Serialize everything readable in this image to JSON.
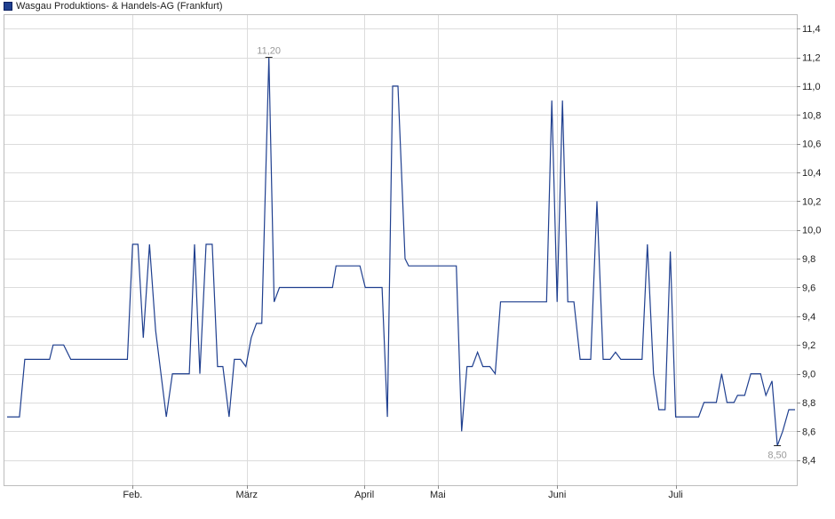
{
  "chart_data": {
    "type": "line",
    "title": "",
    "xlabel": "",
    "ylabel": "",
    "legend": "top-left",
    "grid": true,
    "series": [
      {
        "name": "Wasgau Produktions- & Handels-AG (Frankfurt)",
        "color": "#1f3f8f",
        "points": [
          [
            4,
            8.7
          ],
          [
            18,
            8.7
          ],
          [
            24,
            9.1
          ],
          [
            52,
            9.1
          ],
          [
            56,
            9.2
          ],
          [
            68,
            9.2
          ],
          [
            76,
            9.1
          ],
          [
            140,
            9.1
          ],
          [
            146,
            9.9
          ],
          [
            152,
            9.9
          ],
          [
            158,
            9.25
          ],
          [
            165,
            9.9
          ],
          [
            172,
            9.3
          ],
          [
            184,
            8.7
          ],
          [
            191,
            9.0
          ],
          [
            210,
            9.0
          ],
          [
            216,
            9.9
          ],
          [
            222,
            9.0
          ],
          [
            229,
            9.9
          ],
          [
            236,
            9.9
          ],
          [
            242,
            9.05
          ],
          [
            248,
            9.05
          ],
          [
            255,
            8.7
          ],
          [
            261,
            9.1
          ],
          [
            268,
            9.1
          ],
          [
            274,
            9.05
          ],
          [
            280,
            9.25
          ],
          [
            286,
            9.35
          ],
          [
            292,
            9.35
          ],
          [
            300,
            11.2
          ],
          [
            306,
            9.5
          ],
          [
            312,
            9.6
          ],
          [
            372,
            9.6
          ],
          [
            376,
            9.75
          ],
          [
            403,
            9.75
          ],
          [
            409,
            9.6
          ],
          [
            428,
            9.6
          ],
          [
            434,
            8.7
          ],
          [
            440,
            11.0
          ],
          [
            446,
            11.0
          ],
          [
            454,
            9.8
          ],
          [
            458,
            9.75
          ],
          [
            512,
            9.75
          ],
          [
            518,
            8.6
          ],
          [
            524,
            9.05
          ],
          [
            530,
            9.05
          ],
          [
            536,
            9.15
          ],
          [
            542,
            9.05
          ],
          [
            550,
            9.05
          ],
          [
            556,
            9.0
          ],
          [
            562,
            9.5
          ],
          [
            614,
            9.5
          ],
          [
            620,
            10.9
          ],
          [
            626,
            9.5
          ],
          [
            632,
            10.9
          ],
          [
            638,
            9.5
          ],
          [
            645,
            9.5
          ],
          [
            652,
            9.1
          ],
          [
            664,
            9.1
          ],
          [
            671,
            10.2
          ],
          [
            678,
            9.1
          ],
          [
            686,
            9.1
          ],
          [
            692,
            9.15
          ],
          [
            698,
            9.1
          ],
          [
            722,
            9.1
          ],
          [
            728,
            9.9
          ],
          [
            735,
            9.0
          ],
          [
            741,
            8.75
          ],
          [
            748,
            8.75
          ],
          [
            754,
            9.85
          ],
          [
            760,
            8.7
          ],
          [
            786,
            8.7
          ],
          [
            792,
            8.8
          ],
          [
            806,
            8.8
          ],
          [
            812,
            9.0
          ],
          [
            818,
            8.8
          ],
          [
            826,
            8.8
          ],
          [
            830,
            8.85
          ],
          [
            838,
            8.85
          ],
          [
            845,
            9.0
          ],
          [
            856,
            9.0
          ],
          [
            862,
            8.85
          ],
          [
            869,
            8.95
          ],
          [
            875,
            8.5
          ],
          [
            881,
            8.6
          ],
          [
            888,
            8.75
          ],
          [
            895,
            8.75
          ]
        ]
      }
    ],
    "x_ticks": [
      {
        "x": 146,
        "label": "Feb."
      },
      {
        "x": 275,
        "label": "März"
      },
      {
        "x": 408,
        "label": "April"
      },
      {
        "x": 491,
        "label": "Mai"
      },
      {
        "x": 626,
        "label": "Juni"
      },
      {
        "x": 760,
        "label": "Juli"
      }
    ],
    "x_grid": [
      146,
      275,
      408,
      491,
      626,
      760
    ],
    "y_ticks": [
      {
        "value": 8.4,
        "label": "8,4"
      },
      {
        "value": 8.6,
        "label": "8,6"
      },
      {
        "value": 8.8,
        "label": "8,8"
      },
      {
        "value": 9.0,
        "label": "9,0"
      },
      {
        "value": 9.2,
        "label": "9,2"
      },
      {
        "value": 9.4,
        "label": "9,4"
      },
      {
        "value": 9.6,
        "label": "9,6"
      },
      {
        "value": 9.8,
        "label": "9,8"
      },
      {
        "value": 10.0,
        "label": "10,0"
      },
      {
        "value": 10.2,
        "label": "10,2"
      },
      {
        "value": 10.4,
        "label": "10,4"
      },
      {
        "value": 10.6,
        "label": "10,6"
      },
      {
        "value": 10.8,
        "label": "10,8"
      },
      {
        "value": 11.0,
        "label": "11,0"
      },
      {
        "value": 11.2,
        "label": "11,2"
      },
      {
        "value": 11.4,
        "label": "11,4"
      }
    ],
    "ylim": [
      8.225,
      11.5
    ],
    "xlim": [
      0,
      897
    ],
    "annotations": [
      {
        "x": 300,
        "value": 11.2,
        "label": "11,20",
        "position": "above"
      },
      {
        "x": 875,
        "value": 8.5,
        "label": "8,50",
        "position": "below"
      }
    ]
  }
}
